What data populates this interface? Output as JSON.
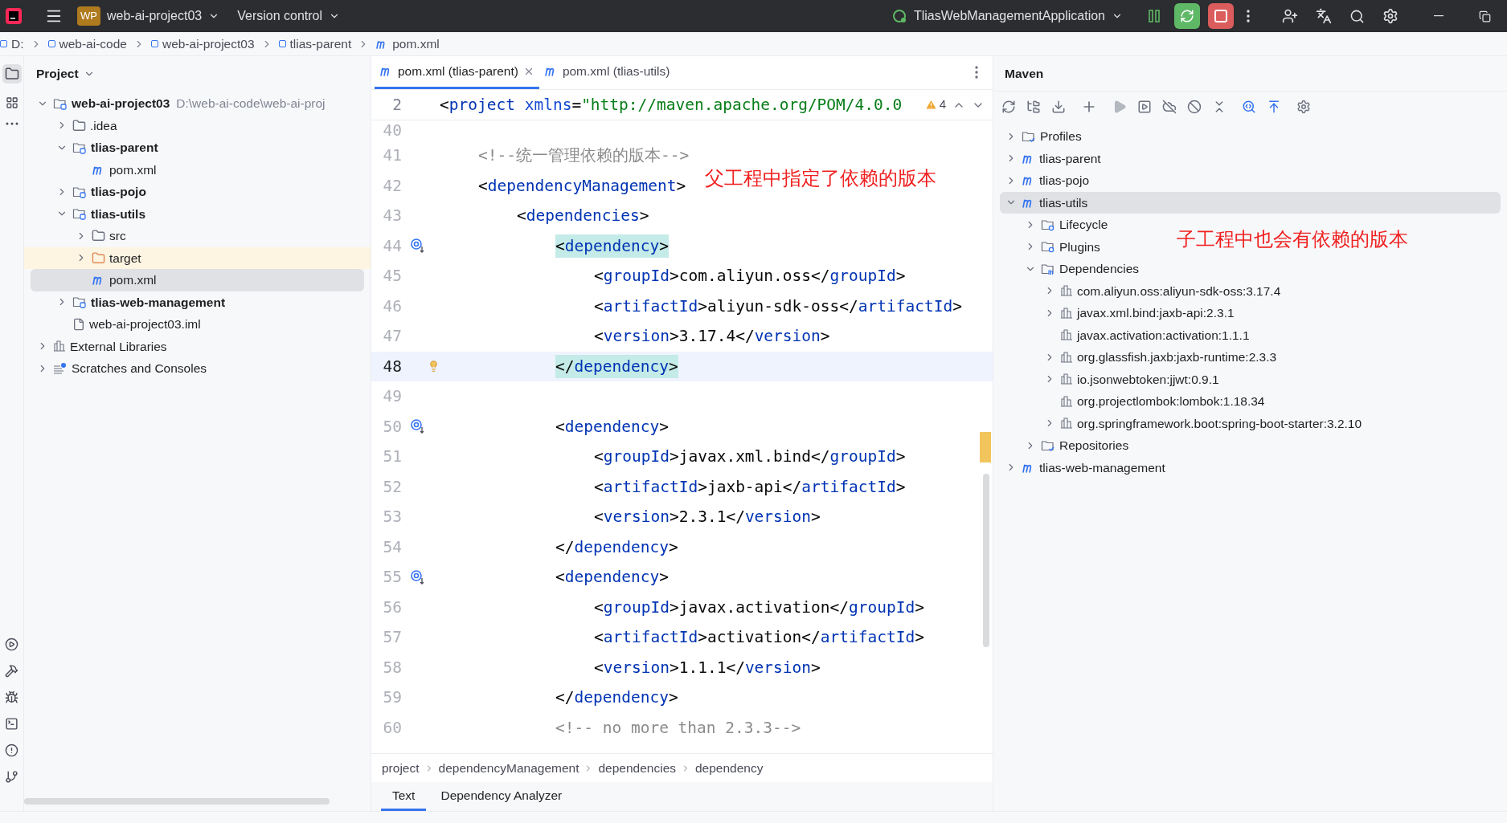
{
  "title_bar": {
    "project_badge": "WP",
    "project": "web-ai-project03",
    "vcs": "Version control",
    "run_config": "TliasWebManagementApplication"
  },
  "breadcrumb": [
    {
      "label": "D:",
      "kind": "drive"
    },
    {
      "label": "web-ai-code",
      "kind": "module"
    },
    {
      "label": "web-ai-project03",
      "kind": "module"
    },
    {
      "label": "tlias-parent",
      "kind": "module"
    },
    {
      "label": "pom.xml",
      "kind": "maven"
    }
  ],
  "project_panel": {
    "title": "Project",
    "tree": [
      {
        "label": "web-ai-project03",
        "kind": "module",
        "bold": true,
        "path": "D:\\web-ai-code\\web-ai-proj",
        "expanded": true,
        "selected": false,
        "children": [
          {
            "label": ".idea",
            "kind": "folder",
            "expanded": false,
            "selected": false
          },
          {
            "label": "tlias-parent",
            "kind": "module",
            "bold": true,
            "expanded": true,
            "selected": false,
            "children": [
              {
                "label": "pom.xml",
                "kind": "maven",
                "selected": false
              }
            ]
          },
          {
            "label": "tlias-pojo",
            "kind": "module",
            "bold": true,
            "expanded": false,
            "selected": false
          },
          {
            "label": "tlias-utils",
            "kind": "module",
            "bold": true,
            "expanded": true,
            "selected": false,
            "children": [
              {
                "label": "src",
                "kind": "folder",
                "expanded": false,
                "selected": false
              },
              {
                "label": "target",
                "kind": "excluded",
                "expanded": false,
                "selected": false
              },
              {
                "label": "pom.xml",
                "kind": "maven",
                "selected": true
              }
            ]
          },
          {
            "label": "tlias-web-management",
            "kind": "module",
            "bold": true,
            "expanded": false,
            "selected": false
          },
          {
            "label": "web-ai-project03.iml",
            "kind": "file",
            "selected": false
          }
        ]
      },
      {
        "label": "External Libraries",
        "kind": "library",
        "expanded": false,
        "selected": false
      },
      {
        "label": "Scratches and Consoles",
        "kind": "scratches",
        "expanded": false,
        "selected": false
      }
    ]
  },
  "editor": {
    "tabs": [
      {
        "label": "pom.xml (tlias-parent)",
        "selected": true
      },
      {
        "label": "pom.xml (tlias-utils)",
        "selected": false
      }
    ],
    "sticky_line": {
      "number": "2",
      "tokens": [
        {
          "kind": "bracket",
          "text": "<"
        },
        {
          "kind": "tag",
          "text": "project "
        },
        {
          "kind": "attr",
          "text": "xmlns"
        },
        {
          "kind": "bracket",
          "text": "="
        },
        {
          "kind": "string",
          "text": "\"http://maven.apache.org/POM/4.0.0"
        }
      ]
    },
    "warnings": "4",
    "lines": [
      {
        "number": "40"
      },
      {
        "number": "41",
        "kind": "outer",
        "tokens": [
          {
            "kind": "comment",
            "text": "<!--统一管理依赖的版本-->"
          }
        ]
      },
      {
        "number": "42",
        "kind": "outer",
        "tokens": [
          {
            "kind": "bracket",
            "text": "<"
          },
          {
            "kind": "tag",
            "text": "dependencyManagement"
          },
          {
            "kind": "bracket",
            "text": ">"
          }
        ]
      },
      {
        "number": "43",
        "kind": "list",
        "tokens": [
          {
            "kind": "bracket",
            "text": "<"
          },
          {
            "kind": "tag",
            "text": "dependencies"
          },
          {
            "kind": "bracket",
            "text": ">"
          }
        ]
      },
      {
        "number": "44",
        "kind": "item",
        "marker": {
          "kind": "override"
        },
        "matched": true,
        "tokens": [
          {
            "kind": "bracket",
            "text": "<"
          },
          {
            "kind": "tag",
            "text": "dependency"
          },
          {
            "kind": "bracket",
            "text": ">"
          }
        ]
      },
      {
        "number": "45",
        "kind": "field",
        "tokens": [
          {
            "kind": "bracket",
            "text": "<"
          },
          {
            "kind": "tag",
            "text": "groupId"
          },
          {
            "kind": "bracket",
            "text": ">"
          },
          {
            "kind": "text",
            "text": "com.aliyun.oss"
          },
          {
            "kind": "bracket",
            "text": "</"
          },
          {
            "kind": "tag",
            "text": "groupId"
          },
          {
            "kind": "bracket",
            "text": ">"
          }
        ]
      },
      {
        "number": "46",
        "kind": "field",
        "tokens": [
          {
            "kind": "bracket",
            "text": "<"
          },
          {
            "kind": "tag",
            "text": "artifactId"
          },
          {
            "kind": "bracket",
            "text": ">"
          },
          {
            "kind": "text",
            "text": "aliyun-sdk-oss"
          },
          {
            "kind": "bracket",
            "text": "</"
          },
          {
            "kind": "tag",
            "text": "artifactId"
          },
          {
            "kind": "bracket",
            "text": ">"
          }
        ]
      },
      {
        "number": "47",
        "kind": "field",
        "tokens": [
          {
            "kind": "bracket",
            "text": "<"
          },
          {
            "kind": "tag",
            "text": "version"
          },
          {
            "kind": "bracket",
            "text": ">"
          },
          {
            "kind": "text",
            "text": "3.17.4"
          },
          {
            "kind": "bracket",
            "text": "</"
          },
          {
            "kind": "tag",
            "text": "version"
          },
          {
            "kind": "bracket",
            "text": ">"
          }
        ]
      },
      {
        "number": "48",
        "kind": "item",
        "marker": {
          "kind": "bulb"
        },
        "current": true,
        "matched": true,
        "tokens": [
          {
            "kind": "bracket",
            "text": "</"
          },
          {
            "kind": "tag",
            "text": "dependency"
          },
          {
            "kind": "bracket",
            "text": ">"
          }
        ]
      },
      {
        "number": "49"
      },
      {
        "number": "50",
        "kind": "item",
        "marker": {
          "kind": "override"
        },
        "tokens": [
          {
            "kind": "bracket",
            "text": "<"
          },
          {
            "kind": "tag",
            "text": "dependency"
          },
          {
            "kind": "bracket",
            "text": ">"
          }
        ]
      },
      {
        "number": "51",
        "kind": "field",
        "tokens": [
          {
            "kind": "bracket",
            "text": "<"
          },
          {
            "kind": "tag",
            "text": "groupId"
          },
          {
            "kind": "bracket",
            "text": ">"
          },
          {
            "kind": "text",
            "text": "javax.xml.bind"
          },
          {
            "kind": "bracket",
            "text": "</"
          },
          {
            "kind": "tag",
            "text": "groupId"
          },
          {
            "kind": "bracket",
            "text": ">"
          }
        ]
      },
      {
        "number": "52",
        "kind": "field",
        "tokens": [
          {
            "kind": "bracket",
            "text": "<"
          },
          {
            "kind": "tag",
            "text": "artifactId"
          },
          {
            "kind": "bracket",
            "text": ">"
          },
          {
            "kind": "text",
            "text": "jaxb-api"
          },
          {
            "kind": "bracket",
            "text": "</"
          },
          {
            "kind": "tag",
            "text": "artifactId"
          },
          {
            "kind": "bracket",
            "text": ">"
          }
        ]
      },
      {
        "number": "53",
        "kind": "field",
        "tokens": [
          {
            "kind": "bracket",
            "text": "<"
          },
          {
            "kind": "tag",
            "text": "version"
          },
          {
            "kind": "bracket",
            "text": ">"
          },
          {
            "kind": "text",
            "text": "2.3.1"
          },
          {
            "kind": "bracket",
            "text": "</"
          },
          {
            "kind": "tag",
            "text": "version"
          },
          {
            "kind": "bracket",
            "text": ">"
          }
        ]
      },
      {
        "number": "54",
        "kind": "item",
        "tokens": [
          {
            "kind": "bracket",
            "text": "</"
          },
          {
            "kind": "tag",
            "text": "dependency"
          },
          {
            "kind": "bracket",
            "text": ">"
          }
        ]
      },
      {
        "number": "55",
        "kind": "item",
        "marker": {
          "kind": "override"
        },
        "tokens": [
          {
            "kind": "bracket",
            "text": "<"
          },
          {
            "kind": "tag",
            "text": "dependency"
          },
          {
            "kind": "bracket",
            "text": ">"
          }
        ]
      },
      {
        "number": "56",
        "kind": "field",
        "tokens": [
          {
            "kind": "bracket",
            "text": "<"
          },
          {
            "kind": "tag",
            "text": "groupId"
          },
          {
            "kind": "bracket",
            "text": ">"
          },
          {
            "kind": "text",
            "text": "javax.activation"
          },
          {
            "kind": "bracket",
            "text": "</"
          },
          {
            "kind": "tag",
            "text": "groupId"
          },
          {
            "kind": "bracket",
            "text": ">"
          }
        ]
      },
      {
        "number": "57",
        "kind": "field",
        "tokens": [
          {
            "kind": "bracket",
            "text": "<"
          },
          {
            "kind": "tag",
            "text": "artifactId"
          },
          {
            "kind": "bracket",
            "text": ">"
          },
          {
            "kind": "text",
            "text": "activation"
          },
          {
            "kind": "bracket",
            "text": "</"
          },
          {
            "kind": "tag",
            "text": "artifactId"
          },
          {
            "kind": "bracket",
            "text": ">"
          }
        ]
      },
      {
        "number": "58",
        "kind": "field",
        "tokens": [
          {
            "kind": "bracket",
            "text": "<"
          },
          {
            "kind": "tag",
            "text": "version"
          },
          {
            "kind": "bracket",
            "text": ">"
          },
          {
            "kind": "text",
            "text": "1.1.1"
          },
          {
            "kind": "bracket",
            "text": "</"
          },
          {
            "kind": "tag",
            "text": "version"
          },
          {
            "kind": "bracket",
            "text": ">"
          }
        ]
      },
      {
        "number": "59",
        "kind": "item",
        "tokens": [
          {
            "kind": "bracket",
            "text": "</"
          },
          {
            "kind": "tag",
            "text": "dependency"
          },
          {
            "kind": "bracket",
            "text": ">"
          }
        ]
      },
      {
        "number": "60",
        "kind": "item",
        "tokens": [
          {
            "kind": "comment",
            "text": "<!-- no more than 2.3.3-->"
          }
        ]
      }
    ],
    "annotation": "父工程中指定了依赖的版本",
    "path_bar": [
      "project",
      "dependencyManagement",
      "dependencies",
      "dependency"
    ],
    "bottom_tabs": [
      {
        "label": "Text",
        "selected": true
      },
      {
        "label": "Dependency Analyzer",
        "selected": false
      }
    ]
  },
  "maven": {
    "title": "Maven",
    "annotation": "子工程中也会有依赖的版本",
    "tree": [
      {
        "label": "Profiles",
        "kind": "folder-check",
        "expanded": false,
        "selected": false
      },
      {
        "label": "tlias-parent",
        "kind": "maven",
        "expanded": false,
        "selected": false
      },
      {
        "label": "tlias-pojo",
        "kind": "maven",
        "expanded": false,
        "selected": false
      },
      {
        "label": "tlias-utils",
        "kind": "maven",
        "expanded": true,
        "selected": true,
        "children": [
          {
            "label": "Lifecycle",
            "kind": "folder-gear",
            "expanded": false,
            "selected": false
          },
          {
            "label": "Plugins",
            "kind": "folder-gear",
            "expanded": false,
            "selected": false
          },
          {
            "label": "Dependencies",
            "kind": "folder-lib",
            "expanded": true,
            "selected": false,
            "children": [
              {
                "label": "com.aliyun.oss:aliyun-sdk-oss:3.17.4",
                "kind": "library",
                "expanded": false,
                "selected": false
              },
              {
                "label": "javax.xml.bind:jaxb-api:2.3.1",
                "kind": "library",
                "expanded": false,
                "selected": false
              },
              {
                "label": "javax.activation:activation:1.1.1",
                "kind": "library",
                "selected": false
              },
              {
                "label": "org.glassfish.jaxb:jaxb-runtime:2.3.3",
                "kind": "library",
                "expanded": false,
                "selected": false
              },
              {
                "label": "io.jsonwebtoken:jjwt:0.9.1",
                "kind": "library",
                "expanded": false,
                "selected": false
              },
              {
                "label": "org.projectlombok:lombok:1.18.34",
                "kind": "library",
                "selected": false
              },
              {
                "label": "org.springframework.boot:spring-boot-starter:3.2.10",
                "kind": "library",
                "expanded": false,
                "selected": false
              }
            ]
          },
          {
            "label": "Repositories",
            "kind": "folder-check",
            "expanded": false,
            "selected": false
          }
        ]
      },
      {
        "label": "tlias-web-management",
        "kind": "maven",
        "expanded": false,
        "selected": false
      }
    ]
  }
}
